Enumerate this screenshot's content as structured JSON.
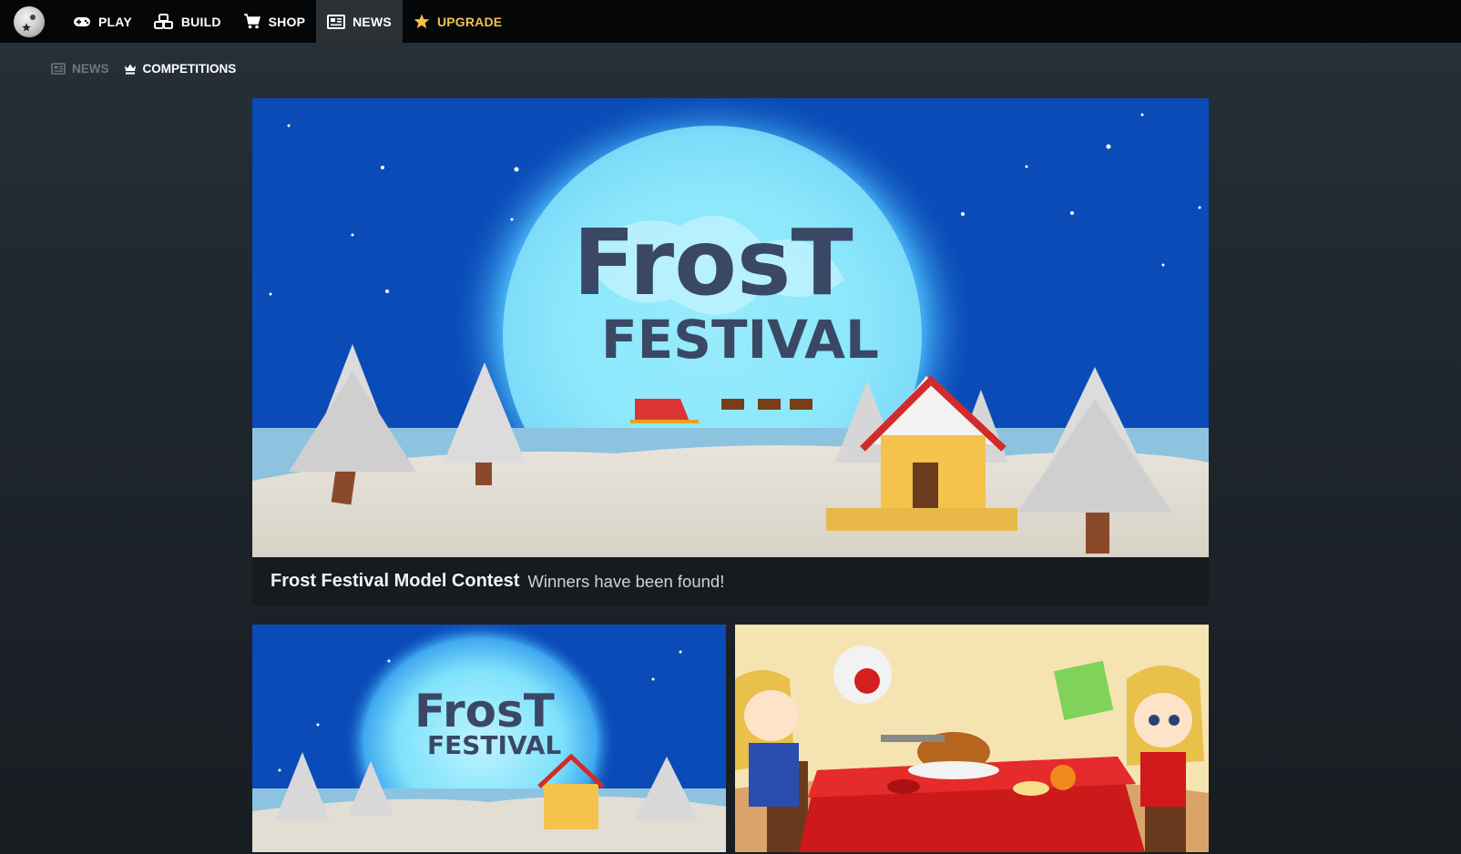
{
  "nav": {
    "items": [
      {
        "key": "play",
        "label": "PLAY",
        "icon": "gamepad-icon"
      },
      {
        "key": "build",
        "label": "BUILD",
        "icon": "blocks-icon"
      },
      {
        "key": "shop",
        "label": "SHOP",
        "icon": "cart-icon"
      },
      {
        "key": "news",
        "label": "NEWS",
        "icon": "newspaper-icon",
        "active": true
      },
      {
        "key": "upgrade",
        "label": "UPGRADE",
        "icon": "star-icon",
        "color": "#f1c34b"
      }
    ]
  },
  "subnav": {
    "news_label": "NEWS",
    "competitions_label": "COMPETITIONS"
  },
  "hero": {
    "art_title_line1": "FrosT",
    "art_title_line2": "FESTIVAL",
    "title": "Frost Festival Model Contest",
    "subtitle": "Winners have been found!"
  },
  "thumbs": {
    "left_art_line1": "FrosT",
    "left_art_line2": "FESTIVAL"
  },
  "colors": {
    "topbar": "#050607",
    "active_tab": "#2c3136",
    "upgrade": "#f1c34b",
    "sky": "#0a4bb8"
  }
}
